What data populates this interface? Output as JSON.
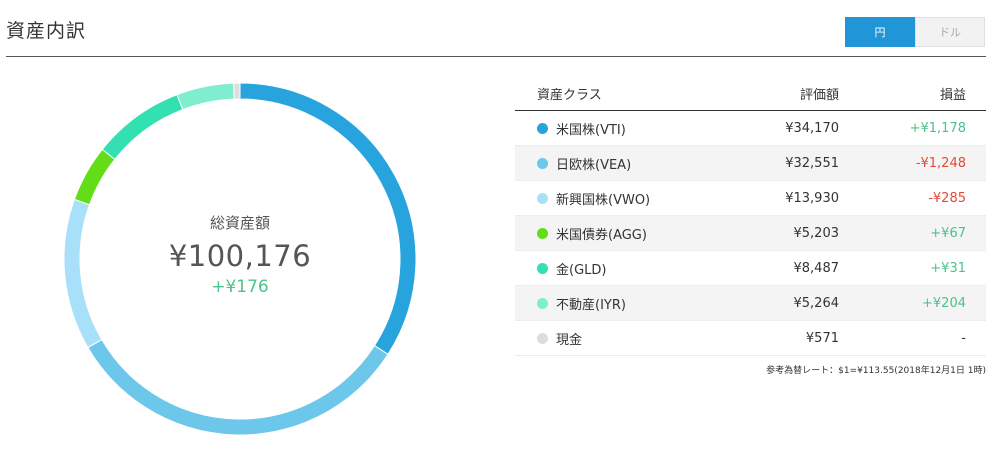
{
  "header": {
    "title": "資産内訳",
    "currency_toggle": [
      {
        "label": "円",
        "active": true
      },
      {
        "label": "ドル",
        "active": false
      }
    ]
  },
  "summary": {
    "label": "総資産額",
    "value": "¥100,176",
    "gain": "+¥176"
  },
  "table": {
    "headers": {
      "asset_class": "資産クラス",
      "valuation": "評価額",
      "gain": "損益"
    },
    "rows": [
      {
        "name": "米国株(VTI)",
        "value": "¥34,170",
        "gain": "+¥1,178",
        "gain_type": "pos",
        "color": "#27a4dd"
      },
      {
        "name": "日欧株(VEA)",
        "value": "¥32,551",
        "gain": "-¥1,248",
        "gain_type": "neg",
        "color": "#6cc7ea"
      },
      {
        "name": "新興国株(VWO)",
        "value": "¥13,930",
        "gain": "-¥285",
        "gain_type": "neg",
        "color": "#a8e0f9"
      },
      {
        "name": "米国債券(AGG)",
        "value": "¥5,203",
        "gain": "+¥67",
        "gain_type": "pos",
        "color": "#62dd18"
      },
      {
        "name": "金(GLD)",
        "value": "¥8,487",
        "gain": "+¥31",
        "gain_type": "pos",
        "color": "#33e0b2"
      },
      {
        "name": "不動産(IYR)",
        "value": "¥5,264",
        "gain": "+¥204",
        "gain_type": "pos",
        "color": "#7fedcf"
      },
      {
        "name": "現金",
        "value": "¥571",
        "gain": "-",
        "gain_type": "neutral",
        "color": "#dddddd"
      }
    ],
    "rate_note": "参考為替レート：$1=¥113.55(2018年12月1日 1時)"
  },
  "chart_data": {
    "type": "pie",
    "categories": [
      "米国株(VTI)",
      "日欧株(VEA)",
      "新興国株(VWO)",
      "米国債券(AGG)",
      "金(GLD)",
      "不動産(IYR)",
      "現金"
    ],
    "values": [
      34170,
      32551,
      13930,
      5203,
      8487,
      5264,
      571
    ],
    "colors": [
      "#27a4dd",
      "#6cc7ea",
      "#a8e0f9",
      "#62dd18",
      "#33e0b2",
      "#7fedcf",
      "#dddddd"
    ]
  }
}
